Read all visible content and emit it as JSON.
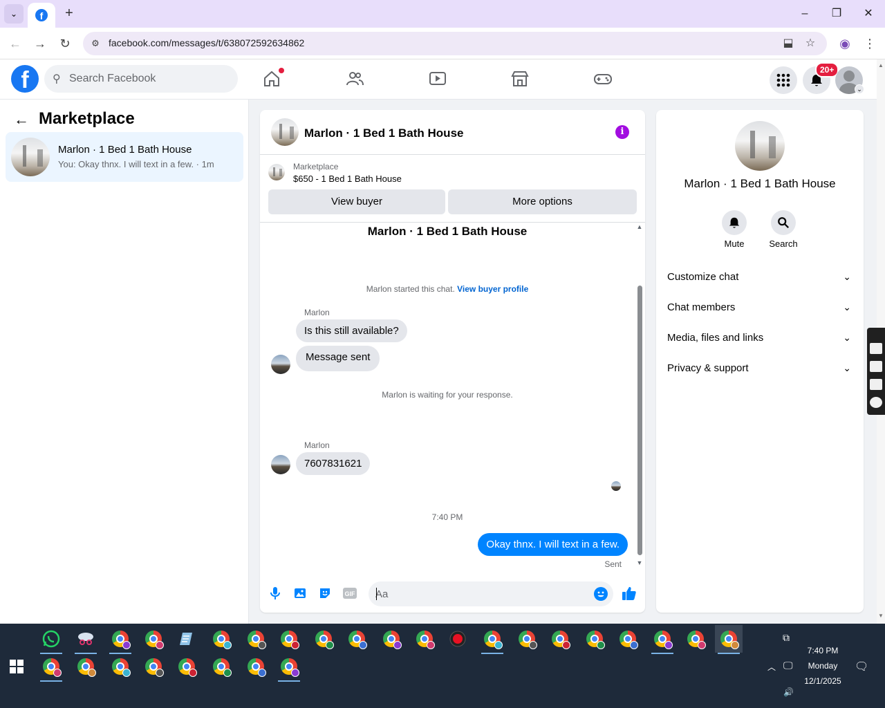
{
  "browser": {
    "url": "facebook.com/messages/t/638072592634862",
    "new_tab": "+",
    "minimize": "–",
    "restore": "❐",
    "close": "✕"
  },
  "fb_header": {
    "logo": "f",
    "search_placeholder": "Search Facebook",
    "notification_badge": "20+",
    "home_has_dot": true
  },
  "left_pane": {
    "title": "Marketplace",
    "conversation": {
      "name": "Marlon · 1 Bed 1 Bath House",
      "snippet": "You: Okay thnx. I will text in a few. · 1m"
    }
  },
  "chat": {
    "header_title": "Marlon · 1 Bed 1 Bath House",
    "marketplace_label": "Marketplace",
    "listing": "$650 - 1 Bed 1 Bath House",
    "view_buyer_button": "View buyer",
    "more_options_button": "More options",
    "thread_title": "Marlon · 1 Bed 1 Bath House",
    "started_text": "Marlon started this chat.",
    "view_buyer_profile_link": "View buyer profile",
    "sender_1": "Marlon",
    "msg_1": "Is this still available?",
    "msg_2": "Message sent",
    "waiting_text": "Marlon is waiting for your response.",
    "sender_2": "Marlon",
    "msg_3": "7607831621",
    "timestamp": "7:40 PM",
    "my_msg": "Okay thnx. I will text in a few.",
    "sent_status": "Sent",
    "composer_placeholder": "Aa"
  },
  "right_panel": {
    "name": "Marlon · 1 Bed 1 Bath House",
    "mute_label": "Mute",
    "search_label": "Search",
    "sections": [
      "Customize chat",
      "Chat members",
      "Media, files and links",
      "Privacy & support"
    ]
  },
  "taskbar": {
    "time": "7:40 PM",
    "day": "Monday",
    "date": "12/1/2025"
  },
  "colors": {
    "fb_blue": "#1877f2",
    "messenger_blue": "#0084ff",
    "info_purple": "#a20de0",
    "notification_red": "#e41e3f"
  }
}
